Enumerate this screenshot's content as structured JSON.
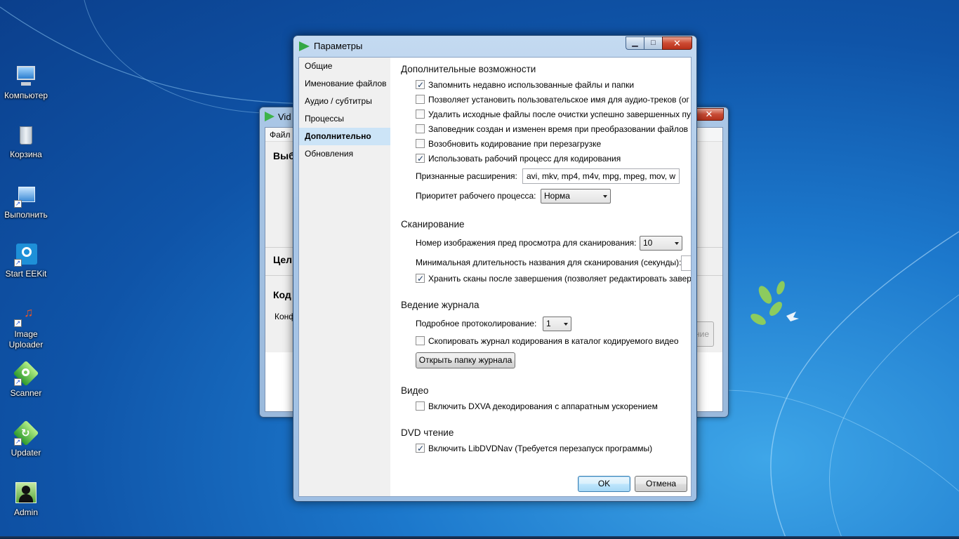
{
  "desktop": {
    "icons": [
      {
        "label": "Компьютер"
      },
      {
        "label": "Корзина"
      },
      {
        "label": "Выполнить"
      },
      {
        "label": "Start EEKit"
      },
      {
        "label": "Image Uploader"
      },
      {
        "label": "Scanner"
      },
      {
        "label": "Updater"
      },
      {
        "label": "Admin"
      }
    ]
  },
  "background_window": {
    "title": "Vid",
    "menu_file": "Файл",
    "section1": "Выб",
    "section2": "Цел",
    "section3": "Код",
    "config_label": "Конф",
    "button_fragment": "ние"
  },
  "dialog": {
    "title": "Параметры",
    "caption_min": "▁",
    "caption_max": "□",
    "caption_close": "✕",
    "nav": [
      {
        "label": "Общие"
      },
      {
        "label": "Именование файлов"
      },
      {
        "label": "Аудио / субтитры"
      },
      {
        "label": "Процессы"
      },
      {
        "label": "Дополнительно"
      },
      {
        "label": "Обновления"
      }
    ],
    "advanced": {
      "header": "Дополнительные возможности",
      "cb1": "Запомнить недавно использованные файлы и папки",
      "cb2": "Позволяет установить пользовательское имя для аудио-треков (ог",
      "cb3": "Удалить исходные файлы после очистки успешно завершенных пу",
      "cb4": "Заповедник создан и изменен время при преобразовании файлов",
      "cb5": "Возобновить кодирование при перезагрузке",
      "cb6": "Использовать рабочий процесс для кодирования",
      "ext_label": "Признанные расширения:",
      "ext_value": "avi, mkv, mp4, m4v, mpg, mpeg, mov, w",
      "priority_label": "Приоритет рабочего процесса:",
      "priority_value": "Норма"
    },
    "scanning": {
      "header": "Сканирование",
      "preview_label": "Номер изображения пред просмотра для сканирования:",
      "preview_value": "10",
      "min_duration_label": "Минимальная длительность названия для сканирования (секунды):",
      "keep_scans": "Хранить сканы после завершения (позволяет редактировать завер"
    },
    "logging": {
      "header": "Ведение журнала",
      "verbosity_label": "Подробное протоколирование:",
      "verbosity_value": "1",
      "copy_log": "Скопировать журнал кодирования в каталог кодируемого видео",
      "open_log_button": "Открыть папку журнала"
    },
    "video": {
      "header": "Видео",
      "dxva": "Включить DXVA декодирования с аппаратным ускорением"
    },
    "dvd": {
      "header": "DVD чтение",
      "libdvdnav": "Включить LibDVDNav (Требуется перезапуск программы)"
    },
    "ok": "OK",
    "cancel": "Отмена"
  },
  "colors": {
    "desktop_blue": "#1c78cc",
    "nav_active": "#cce4f7",
    "close_red": "#cc4a32"
  }
}
